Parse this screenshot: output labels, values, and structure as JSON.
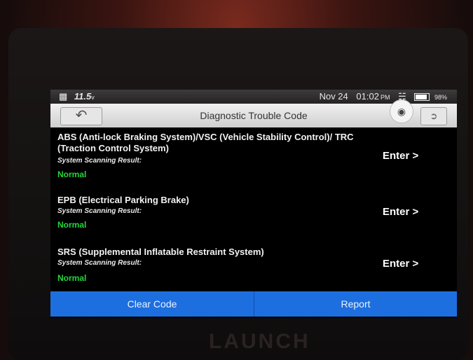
{
  "status_bar": {
    "voltage": "11.5",
    "voltage_unit": "v",
    "date": "Nov 24",
    "time": "01:02",
    "ampm": "PM",
    "battery": "98%"
  },
  "title_bar": {
    "back_icon": "back-arrow-icon",
    "title": "Diagnostic Trouble Code",
    "camera_icon": "camera-icon",
    "exit_icon": "exit-icon"
  },
  "systems": [
    {
      "name": "ABS (Anti-lock Braking System)/VSC (Vehicle Stability Control)/ TRC (Traction Control System)",
      "scan_label": "System Scanning Result:",
      "status": "Normal",
      "enter_label": "Enter >"
    },
    {
      "name": "EPB (Electrical Parking Brake)",
      "scan_label": "System Scanning Result:",
      "status": "Normal",
      "enter_label": "Enter >"
    },
    {
      "name": "SRS (Supplemental Inflatable Restraint System)",
      "scan_label": "System Scanning Result:",
      "status": "Normal",
      "enter_label": "Enter >"
    }
  ],
  "bottom_bar": {
    "clear_code": "Clear Code",
    "report": "Report"
  },
  "device": {
    "brand": "LAUNCH"
  },
  "colors": {
    "accent": "#1d6fe0",
    "status_normal": "#22d63a"
  }
}
